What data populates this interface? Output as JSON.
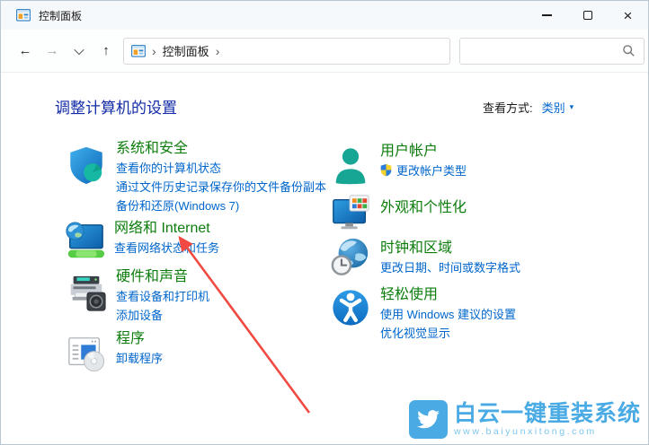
{
  "window": {
    "title": "控制面板"
  },
  "icons": {
    "app": "control-panel",
    "minimize": "minimize-dash",
    "maximize": "maximize-square",
    "close": "×",
    "back": "←",
    "forward": "→",
    "recent_locations": "chevron-down",
    "up": "↑",
    "breadcrumb_chevron": "›",
    "view_dropdown": "▾",
    "search": "magnifier",
    "uac_shield": "blue-yellow-shield"
  },
  "nav": {
    "breadcrumb_root": "控制面板",
    "search_value": ""
  },
  "header": {
    "title": "调整计算机的设置",
    "view_by_label": "查看方式:",
    "view_by_value": "类别"
  },
  "categories": {
    "left": [
      {
        "icon": "security-shield-icon",
        "title": "系统和安全",
        "links": [
          "查看你的计算机状态",
          "通过文件历史记录保存你的文件备份副本",
          "备份和还原(Windows 7)"
        ]
      },
      {
        "icon": "network-monitor-icon",
        "title": "网络和 Internet",
        "links": [
          "查看网络状态和任务"
        ]
      },
      {
        "icon": "printer-sound-icon",
        "title": "硬件和声音",
        "links": [
          "查看设备和打印机",
          "添加设备"
        ]
      },
      {
        "icon": "programs-disc-icon",
        "title": "程序",
        "links": [
          "卸载程序"
        ]
      }
    ],
    "right": [
      {
        "icon": "user-account-icon",
        "title": "用户帐户",
        "links": [
          "更改帐户类型"
        ]
      },
      {
        "icon": "personalization-icon",
        "title": "外观和个性化",
        "links": []
      },
      {
        "icon": "clock-region-icon",
        "title": "时钟和区域",
        "links": [
          "更改日期、时间或数字格式"
        ]
      },
      {
        "icon": "ease-of-access-icon",
        "title": "轻松使用",
        "links": [
          "使用 Windows 建议的设置",
          "优化视觉显示"
        ]
      }
    ]
  },
  "annotation": {
    "type": "red-arrow",
    "points_to": "网络和 Internet"
  },
  "watermark": {
    "title": "白云一键重装系统",
    "url": "www.baiyunxitong.com"
  },
  "colors": {
    "category_green": "#0c7d0c",
    "link_blue": "#0066cc",
    "heading_navy": "#122ba6",
    "arrow_red": "#f04a42",
    "watermark_blue": "#4aabe4"
  }
}
